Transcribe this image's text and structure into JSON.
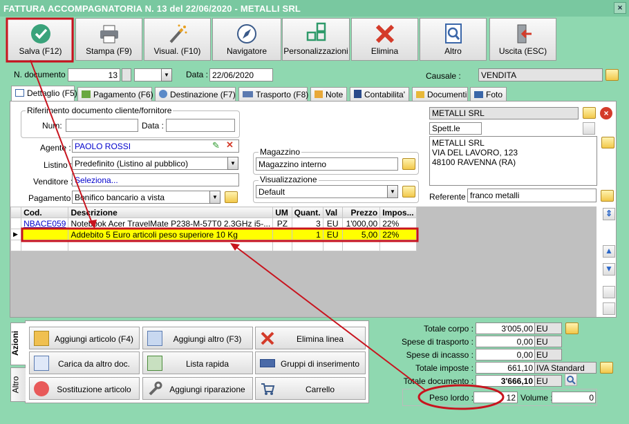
{
  "window": {
    "title": "FATTURA ACCOMPAGNATORIA N. 13 del 22/06/2020 - METALLI SRL",
    "close": "×"
  },
  "toolbar": [
    "Salva (F12)",
    "Stampa (F9)",
    "Visual. (F10)",
    "Navigatore",
    "Personalizzazioni",
    "Elimina",
    "Altro",
    "Uscita (ESC)"
  ],
  "header": {
    "ndoc_label": "N. documento :",
    "ndoc_value": "13",
    "data_label": "Data :",
    "data_value": "22/06/2020",
    "causale_label": "Causale :",
    "causale_value": "VENDITA"
  },
  "tabs": [
    "Dettaglio (F5)",
    "Pagamento (F6)",
    "Destinazione (F7)",
    "Trasporto (F8)",
    "Note",
    "Contabilita'",
    "Documenti",
    "Foto"
  ],
  "riferimento": {
    "title": "Riferimento documento cliente/fornitore",
    "num_label": "Num:",
    "num_value": "",
    "data_label": "Data :",
    "data_value": ""
  },
  "fields": {
    "agente_label": "Agente :",
    "agente_value": "PAOLO ROSSI",
    "listino_label": "Listino :",
    "listino_value": "Predefinito (Listino al pubblico)",
    "venditore_label": "Venditore :",
    "venditore_value": "Seleziona...",
    "pagamento_label": "Pagamento :",
    "pagamento_value": "Bonifico bancario a vista"
  },
  "magazzino": {
    "title": "Magazzino",
    "value": "Magazzino interno"
  },
  "visualizzazione": {
    "title": "Visualizzazione",
    "value": "Default"
  },
  "cliente": {
    "name": "METALLI SRL",
    "short": "Spett.le",
    "address_lines": [
      "METALLI SRL",
      "VIA DEL LAVORO, 123",
      "48100 RAVENNA (RA)"
    ],
    "referente_label": "Referente",
    "referente_value": "franco metalli"
  },
  "grid": {
    "headers": [
      "Cod.",
      "Descrizione",
      "UM",
      "Quant.",
      "Val",
      "Prezzo",
      "Impos..."
    ],
    "rows": [
      [
        "NBACE059",
        "Notebook Acer TravelMate P238-M-57T0 2.3GHz i5-...",
        "PZ",
        "3",
        "EU",
        "1'000,00",
        "22%"
      ],
      [
        "",
        "Addebito 5 Euro articoli peso superiore  10 Kg",
        "",
        "1",
        "EU",
        "5,00",
        "22%"
      ]
    ]
  },
  "side_tabs": [
    "Azioni",
    "Altro"
  ],
  "actions": [
    "Aggiungi articolo (F4)",
    "Aggiungi altro (F3)",
    "Elimina linea",
    "Carica da altro doc.",
    "Lista rapida",
    "Gruppi di inserimento",
    "Sostituzione articolo",
    "Aggiungi riparazione",
    "Carrello"
  ],
  "totals": {
    "totale_corpo_label": "Totale corpo :",
    "totale_corpo": "3'005,00",
    "spese_trasporto_label": "Spese di trasporto :",
    "spese_trasporto": "0,00",
    "spese_incasso_label": "Spese di incasso :",
    "spese_incasso": "0,00",
    "totale_imposte_label": "Totale imposte :",
    "totale_imposte": "661,10",
    "iva_label": "IVA Standard",
    "totale_documento_label": "Totale documento :",
    "totale_documento": "3'666,10",
    "currency": "EU",
    "peso_label": "Peso lordo :",
    "peso_value": "12",
    "volume_label": "Volume :",
    "volume_value": "0"
  },
  "colors": {
    "window_bg": "#8fd8b0",
    "titlebar": "#79c8a0",
    "highlight_row": "#ffff00",
    "annotation": "#c8141e",
    "link": "#0000cc"
  }
}
